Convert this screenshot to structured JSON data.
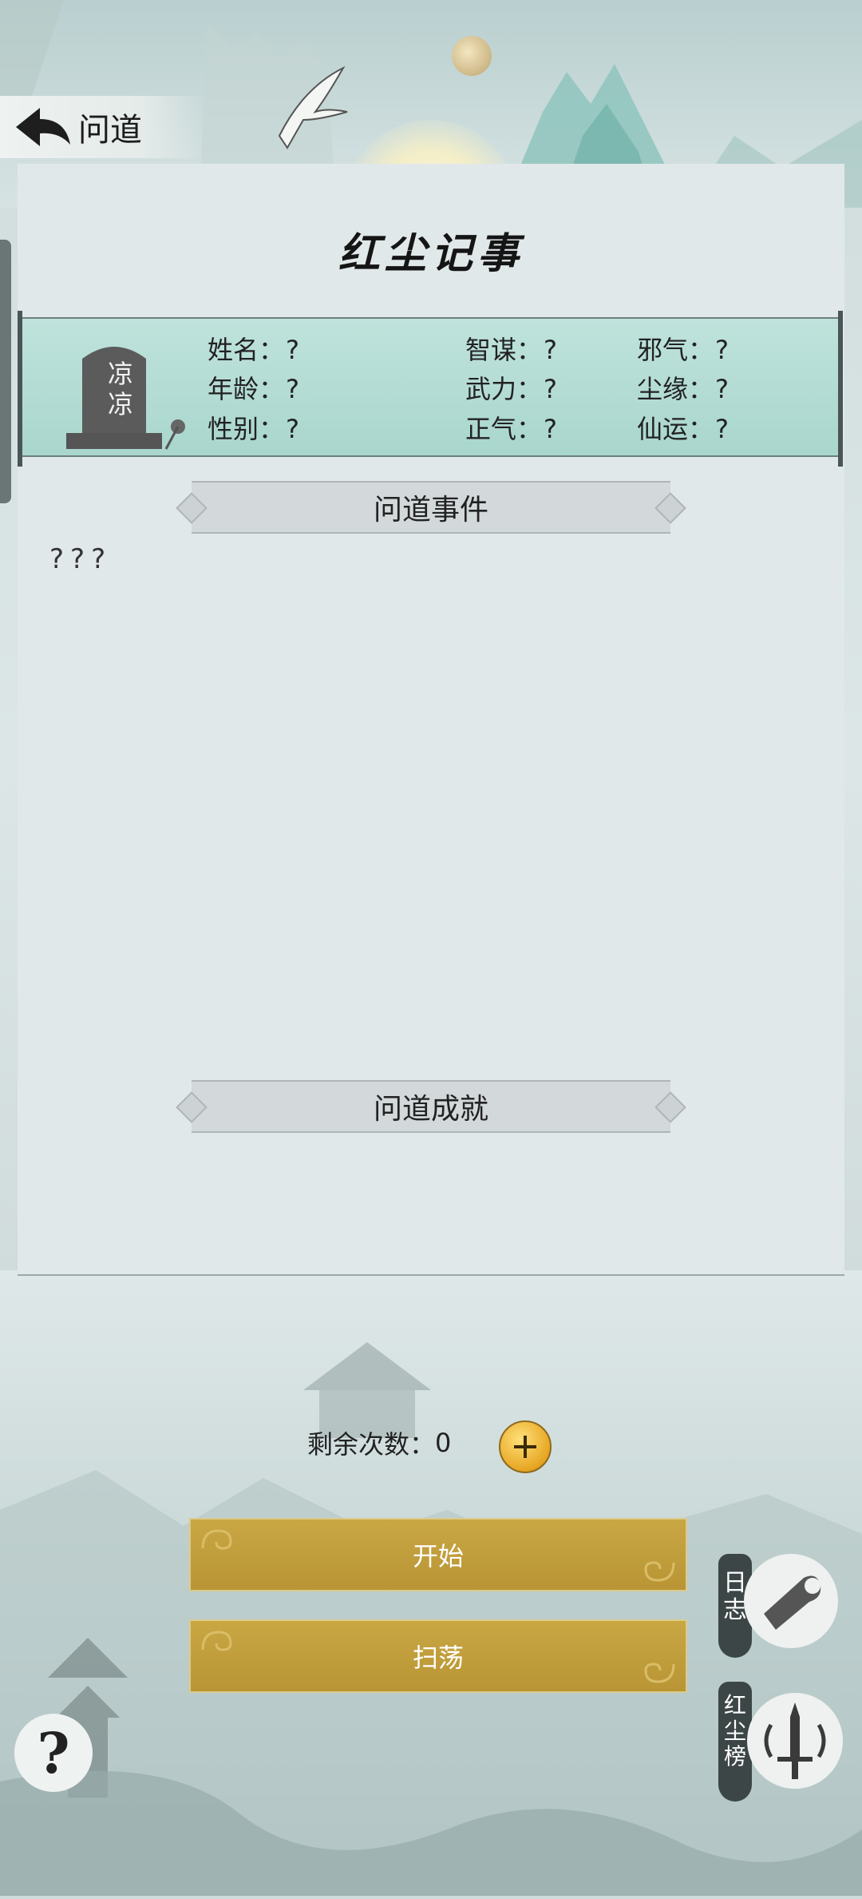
{
  "header": {
    "back_label": "问道"
  },
  "title": "红尘记事",
  "tombstone": {
    "name_text": "凉凉"
  },
  "attributes": [
    {
      "label": "姓名：",
      "value": "?"
    },
    {
      "label": "年龄：",
      "value": "?"
    },
    {
      "label": "性别：",
      "value": "?"
    },
    {
      "label": "智谋：",
      "value": "?"
    },
    {
      "label": "武力：",
      "value": "?"
    },
    {
      "label": "正气：",
      "value": "?"
    },
    {
      "label": "邪气：",
      "value": "?"
    },
    {
      "label": "尘缘：",
      "value": "?"
    },
    {
      "label": "仙运：",
      "value": "?"
    }
  ],
  "sections": {
    "events_title": "问道事件",
    "achievements_title": "问道成就"
  },
  "events_text": "???",
  "remaining": {
    "label": "剩余次数：",
    "count": "0"
  },
  "buttons": {
    "start": "开始",
    "sweep": "扫荡",
    "help": "?"
  },
  "side_buttons": {
    "log_label": "日志",
    "ranking_label": "红尘榜"
  },
  "colors": {
    "accent_gold": "#c1a03e",
    "card_teal": "#b5ddd6",
    "panel": "#e1e8ea"
  }
}
